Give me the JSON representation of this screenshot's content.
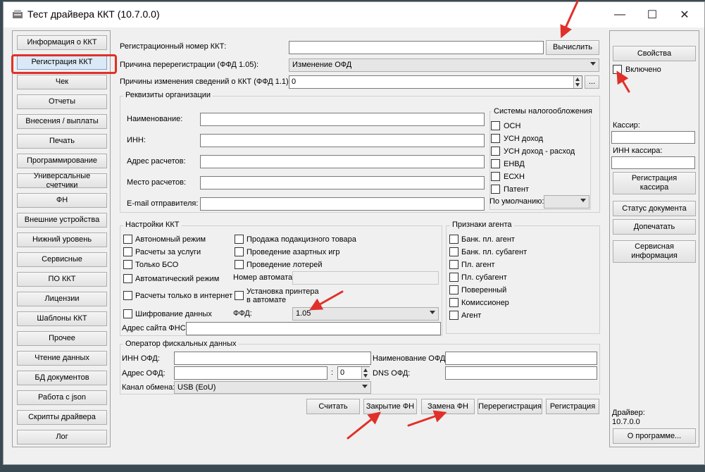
{
  "window": {
    "title": "Тест драйвера ККТ (10.7.0.0)",
    "controls": {
      "minimize": "—",
      "maximize": "☐",
      "close": "✕"
    }
  },
  "nav": {
    "items": [
      "Информация о ККТ",
      "Регистрация ККТ",
      "Чек",
      "Отчеты",
      "Внесения / выплаты",
      "Печать",
      "Программирование",
      "Универсальные счетчики",
      "ФН",
      "Внешние устройства",
      "Нижний уровень",
      "Сервисные",
      "ПО ККТ",
      "Лицензии",
      "Шаблоны ККТ",
      "Прочее",
      "Чтение данных",
      "БД документов",
      "Работа с json",
      "Скрипты драйвера",
      "Лог"
    ],
    "selected": "Регистрация ККТ"
  },
  "registration": {
    "reg_number_label": "Регистрационный номер ККТ:",
    "reg_number_value": "",
    "calc_button": "Вычислить",
    "rereg_reason_label": "Причина перерегистрации (ФФД 1.05):",
    "rereg_reason_value": "Изменение ОФД",
    "change_reasons_label": "Причины изменения сведений о ККТ (ФФД 1.1):",
    "change_reasons_value": "0",
    "change_reasons_more": "..."
  },
  "org": {
    "group_title": "Реквизиты организации",
    "fields": [
      {
        "label": "Наименование:",
        "value": ""
      },
      {
        "label": "ИНН:",
        "value": ""
      },
      {
        "label": "Адрес расчетов:",
        "value": ""
      },
      {
        "label": "Место расчетов:",
        "value": ""
      },
      {
        "label": "E-mail отправителя:",
        "value": ""
      }
    ]
  },
  "tax": {
    "group_title": "Системы налогообложения",
    "items": [
      "ОСН",
      "УСН доход",
      "УСН доход - расход",
      "ЕНВД",
      "ЕСХН",
      "Патент"
    ],
    "default_label": "По умолчанию:",
    "default_value": ""
  },
  "kkt_settings": {
    "group_title": "Настройки ККТ",
    "col1": [
      "Автономный режим",
      "Расчеты за услуги",
      "Только БСО",
      "Автоматический режим",
      "Расчеты только в интернет",
      "Шифрование данных"
    ],
    "col2": [
      "Продажа подакцизного товара",
      "Проведение азартных игр",
      "Проведение лотерей"
    ],
    "automat_label": "Номер автомата:",
    "automat_value": "",
    "printer_label": "Установка принтера в автомате",
    "ffd_label": "ФФД:",
    "ffd_value": "1.05",
    "fns_site_label": "Адрес сайта ФНС:",
    "fns_site_value": ""
  },
  "agent": {
    "group_title": "Признаки агента",
    "items": [
      "Банк. пл. агент",
      "Банк. пл. субагент",
      "Пл. агент",
      "Пл. субагент",
      "Поверенный",
      "Комиссионер",
      "Агент"
    ]
  },
  "ofd": {
    "group_title": "Оператор фискальных данных",
    "inn_label": "ИНН ОФД:",
    "inn_value": "",
    "name_label": "Наименование ОФД:",
    "name_value": "",
    "addr_label": "Адрес ОФД:",
    "addr_value": "",
    "port_sep": ":",
    "port_value": "0",
    "dns_label": "DNS ОФД:",
    "dns_value": "",
    "channel_label": "Канал обмена:",
    "channel_value": "USB (EoU)"
  },
  "actions": {
    "read": "Считать",
    "close_fn": "Закрытие ФН",
    "replace_fn": "Замена ФН",
    "rereg": "Перерегистрация",
    "reg": "Регистрация"
  },
  "right": {
    "properties": "Свойства",
    "enabled_label": "Включено",
    "cashier_label": "Кассир:",
    "cashier_value": "",
    "cashier_inn_label": "ИНН кассира:",
    "cashier_inn_value": "",
    "reg_cashier": "Регистрация кассира",
    "doc_status": "Статус документа",
    "reprint": "Допечатать",
    "service_info": "Сервисная информация",
    "driver_label": "Драйвер:",
    "driver_version": "10.7.0.0",
    "about": "О программе..."
  },
  "colors": {
    "annotation": "#e0302a",
    "selected_nav": "#dbe9f7"
  }
}
